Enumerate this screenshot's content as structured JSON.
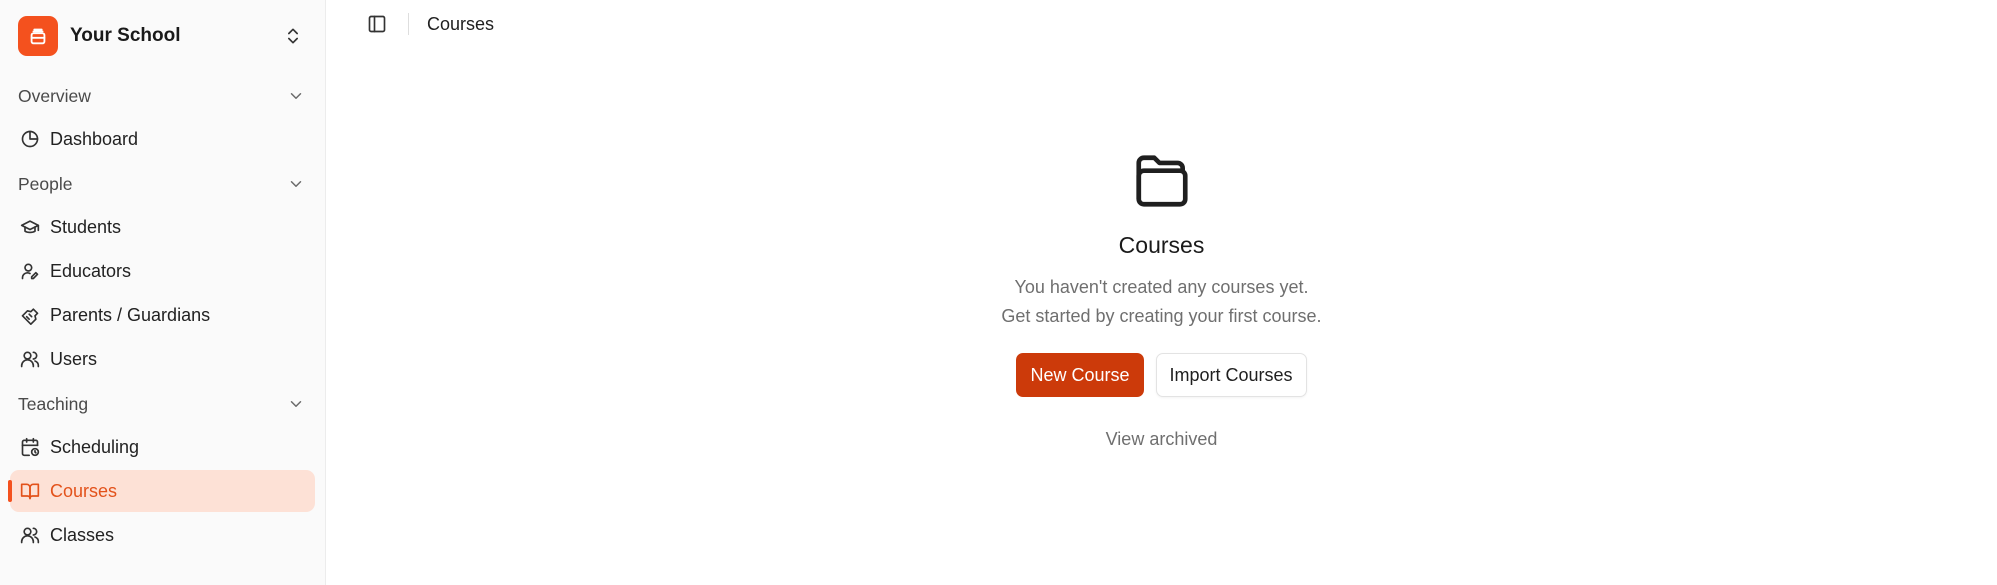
{
  "sidebar": {
    "school_name": "Your School",
    "groups": [
      {
        "label": "Overview",
        "items": [
          {
            "label": "Dashboard",
            "icon": "pie-chart-icon"
          }
        ]
      },
      {
        "label": "People",
        "items": [
          {
            "label": "Students",
            "icon": "graduation-cap-icon"
          },
          {
            "label": "Educators",
            "icon": "user-pen-icon"
          },
          {
            "label": "Parents / Guardians",
            "icon": "handshake-icon"
          },
          {
            "label": "Users",
            "icon": "users-icon"
          }
        ]
      },
      {
        "label": "Teaching",
        "items": [
          {
            "label": "Scheduling",
            "icon": "calendar-clock-icon"
          },
          {
            "label": "Courses",
            "icon": "book-open-icon",
            "active": true
          },
          {
            "label": "Classes",
            "icon": "users-icon"
          }
        ]
      }
    ]
  },
  "header": {
    "breadcrumb": "Courses"
  },
  "empty_state": {
    "icon": "folder-icon",
    "title": "Courses",
    "description_line1": "You haven't created any courses yet.",
    "description_line2": "Get started by creating your first course.",
    "primary_button": "New Course",
    "secondary_button": "Import Courses",
    "link": "View archived"
  },
  "colors": {
    "brand": "#f4511e",
    "primary_button": "#cc3a0a",
    "active_bg": "#fde1d6",
    "active_text": "#e3521b"
  }
}
